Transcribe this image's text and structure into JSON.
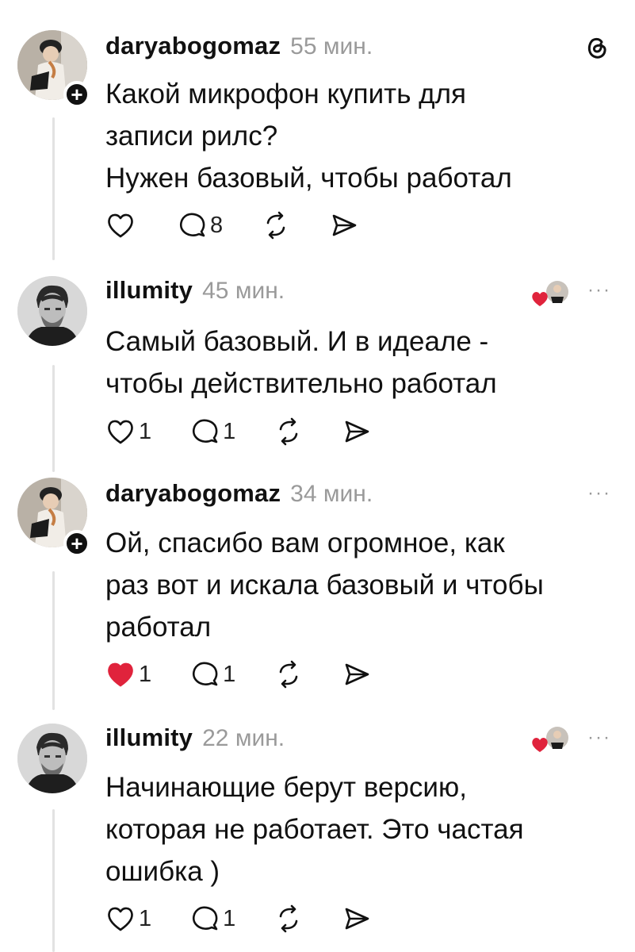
{
  "posts": [
    {
      "username": "daryabogomaz",
      "time": "55 мин.",
      "text": "Какой микрофон купить для\nзаписи рилс?\nНужен базовый, чтобы работал",
      "likes": "",
      "comments": "8",
      "liked": false
    },
    {
      "username": "illumity",
      "time": "45 мин.",
      "text": "Самый базовый. И в идеале -\nчтобы действительно работал",
      "likes": "1",
      "comments": "1",
      "liked": false
    },
    {
      "username": "daryabogomaz",
      "time": "34 мин.",
      "text": "Ой, спасибо вам огромное, как\nраз вот и искала базовый и чтобы\nработал",
      "likes": "1",
      "comments": "1",
      "liked": true
    },
    {
      "username": "illumity",
      "time": "22 мин.",
      "text": "Начинающие берут версию,\nкоторая не работает. Это частая\nошибка )",
      "likes": "1",
      "comments": "1",
      "liked": false
    }
  ],
  "icons": {
    "like": "heart-icon",
    "comment": "comment-icon",
    "repost": "repost-icon",
    "share": "share-icon",
    "more": "more-icon",
    "app": "threads-logo-icon",
    "follow": "plus-icon"
  },
  "more_label": "···",
  "follow_label": "+",
  "colors": {
    "liked_heart": "#e0233c",
    "time": "#9a9a9a",
    "thread_line": "#e2e2e2"
  }
}
